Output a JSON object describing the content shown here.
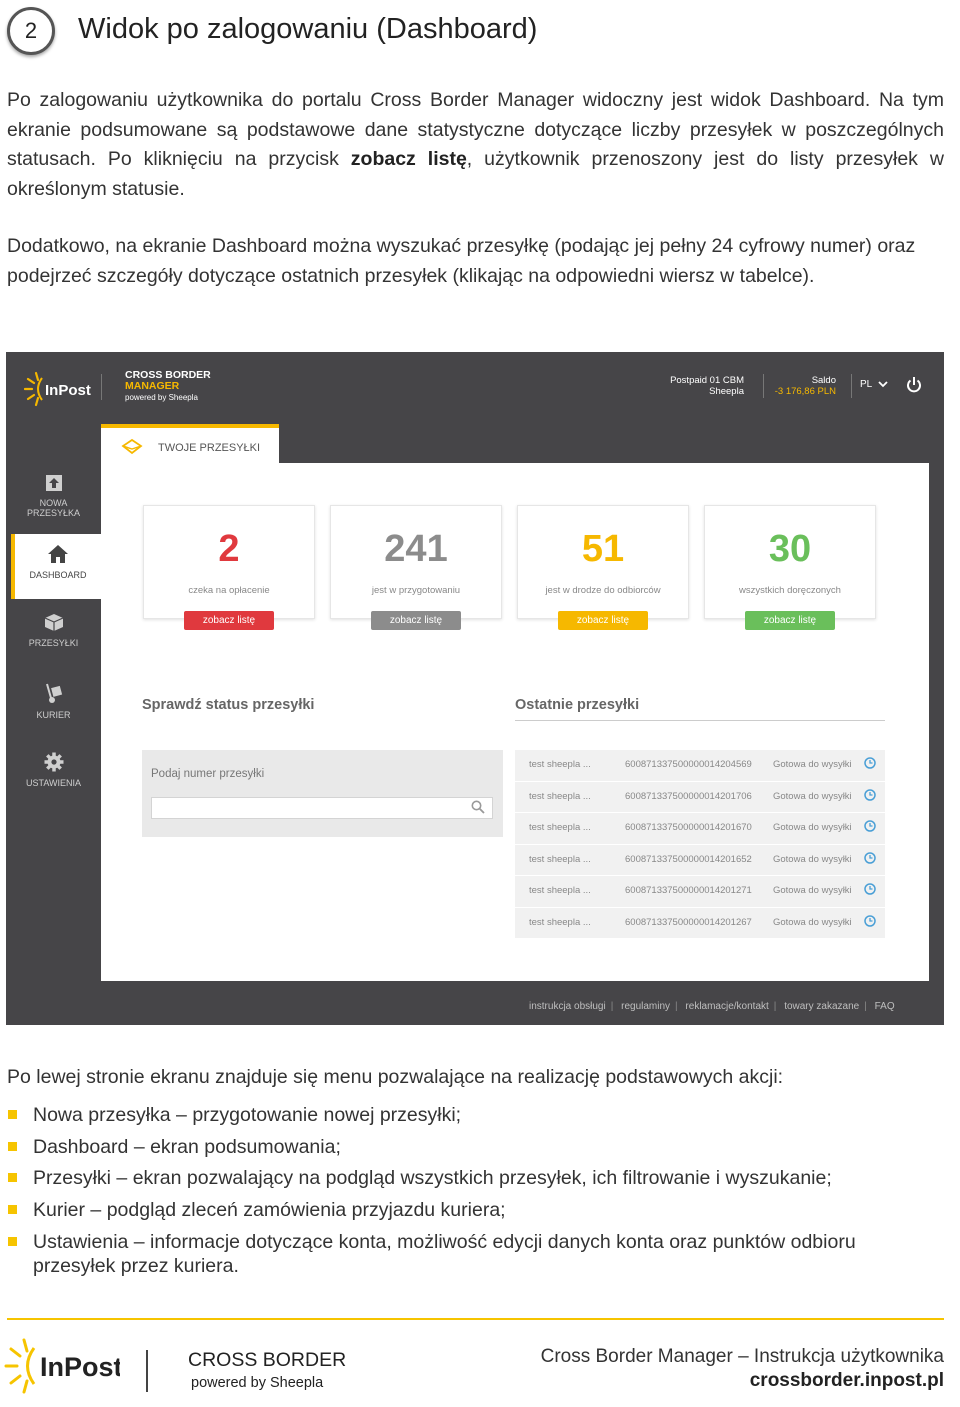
{
  "section": {
    "number": "2",
    "title": "Widok po zalogowaniu (Dashboard)"
  },
  "intro": {
    "p1_a": "Po zalogowaniu użytkownika do portalu Cross Border Manager widoczny jest widok Dashboard. Na tym ekranie podsumowane są podstawowe dane statystyczne dotyczące liczby przesyłek w poszczególnych statusach. Po kliknięciu na przycisk ",
    "p1_bold": "zobacz listę",
    "p1_b": ", użytkownik przenoszony jest do listy przesyłek w określonym statusie.",
    "p2": "Dodatkowo, na ekranie Dashboard można wyszukać przesyłkę (podając jej pełny 24 cyfrowy numer) oraz podejrzeć szczegóły dotyczące ostatnich przesyłek (klikając na odpowiedni wiersz w tabelce)."
  },
  "app": {
    "logo_text": "InPost",
    "brand_line1": "CROSS BORDER",
    "brand_line2": "MANAGER",
    "brand_line3": "powered by Sheepla",
    "account_line1": "Postpaid 01 CBM",
    "account_line2": "Sheepla",
    "saldo_label": "Saldo",
    "saldo_value": "-3 176,86 PLN",
    "lang": "PL",
    "tab_label": "TWOJE PRZESYŁKI",
    "sidebar": [
      {
        "label": "NOWA PRZESYŁKA",
        "icon": "upload-icon"
      },
      {
        "label": "DASHBOARD",
        "icon": "home-icon"
      },
      {
        "label": "PRZESYŁKI",
        "icon": "package-icon"
      },
      {
        "label": "KURIER",
        "icon": "hand-truck-icon"
      },
      {
        "label": "USTAWIENIA",
        "icon": "gear-icon"
      }
    ],
    "stats": [
      {
        "value": "2",
        "caption": "czeka na opłacenie",
        "button": "zobacz listę",
        "color": "#e0393e"
      },
      {
        "value": "241",
        "caption": "jest w przygotowaniu",
        "button": "zobacz listę",
        "color": "#8c8c8c"
      },
      {
        "value": "51",
        "caption": "jest w drodze do odbiorców",
        "button": "zobacz listę",
        "color": "#f6b800"
      },
      {
        "value": "30",
        "caption": "wszystkich doręczonych",
        "button": "zobacz listę",
        "color": "#6abf5b"
      }
    ],
    "status_heading": "Sprawdź status przesyłki",
    "search_label": "Podaj numer przesyłki",
    "recent_heading": "Ostatnie przesyłki",
    "recent": [
      {
        "name": "test sheepla ...",
        "number": "600871337500000014204569",
        "status": "Gotowa do wysyłki"
      },
      {
        "name": "test sheepla ...",
        "number": "600871337500000014201706",
        "status": "Gotowa do wysyłki"
      },
      {
        "name": "test sheepla ...",
        "number": "600871337500000014201670",
        "status": "Gotowa do wysyłki"
      },
      {
        "name": "test sheepla ...",
        "number": "600871337500000014201652",
        "status": "Gotowa do wysyłki"
      },
      {
        "name": "test sheepla ...",
        "number": "600871337500000014201271",
        "status": "Gotowa do wysyłki"
      },
      {
        "name": "test sheepla ...",
        "number": "600871337500000014201267",
        "status": "Gotowa do wysyłki"
      }
    ],
    "footer_links": [
      "instrukcja obsługi",
      "regulaminy",
      "reklamacje/kontakt",
      "towary zakazane",
      "FAQ"
    ]
  },
  "menu": {
    "intro": "Po lewej stronie ekranu znajduje się menu pozwalające na realizację podstawowych akcji:",
    "items": [
      "Nowa przesyłka – przygotowanie nowej przesyłki;",
      "Dashboard – ekran podsumowania;",
      "Przesyłki – ekran pozwalający na podgląd wszystkich przesyłek, ich filtrowanie i wyszukanie;",
      "Kurier – podgląd zleceń zamówienia przyjazdu kuriera;",
      "Ustawienia – informacje dotyczące konta, możliwość edycji danych konta oraz punktów odbioru przesyłek przez kuriera."
    ]
  },
  "footer": {
    "logo_text": "InPost",
    "brand": "CROSS BORDER",
    "powered": "powered by Sheepla",
    "doc_title": "Cross Border Manager – Instrukcja użytkownika",
    "url": "crossborder.inpost.pl"
  },
  "colors": {
    "accent": "#f6b800",
    "dark": "#464548"
  }
}
